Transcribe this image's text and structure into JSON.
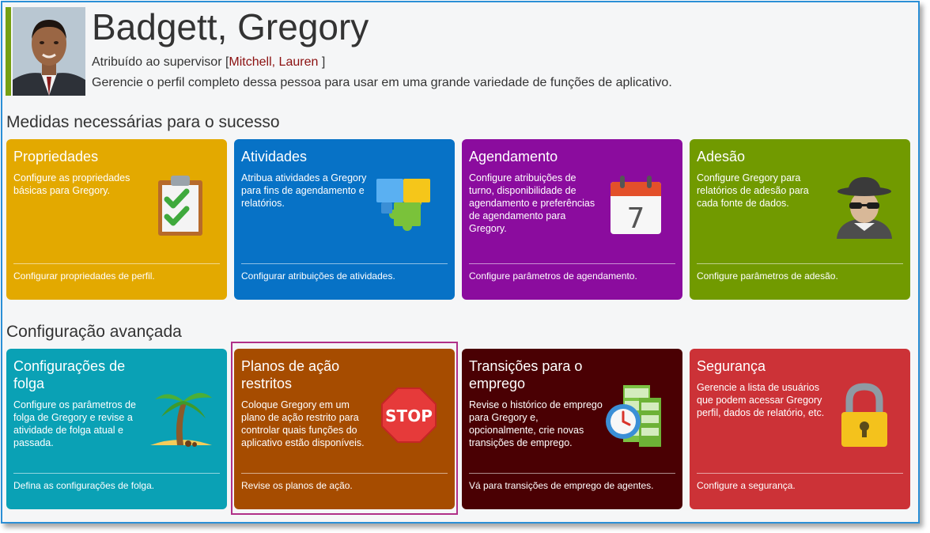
{
  "header": {
    "name": "Badgett, Gregory",
    "supervisor_prefix": "Atribuído ao supervisor [",
    "supervisor_name": "Mitchell, Lauren",
    "supervisor_suffix": " ]",
    "description": "Gerencie o perfil completo dessa pessoa para usar em uma grande variedade de funções de aplicativo."
  },
  "sections": {
    "success": "Medidas necessárias para o sucesso",
    "advanced": "Configuração avançada"
  },
  "tiles": [
    {
      "title": "Propriedades",
      "desc": "Configure as propriedades básicas para Gregory.",
      "footer": "Configurar propriedades de perfil.",
      "icon": "clipboard-check-icon",
      "color": "#e3a900"
    },
    {
      "title": "Atividades",
      "desc": "Atribua atividades a Gregory para fins de agendamento e relatórios.",
      "footer": "Configurar atribuições de atividades.",
      "icon": "puzzle-icon",
      "color": "#0772c6"
    },
    {
      "title": "Agendamento",
      "desc": "Configure atribuições de turno, disponibilidade de agendamento e preferências de agendamento para Gregory.",
      "footer": "Configure parâmetros de agendamento.",
      "icon": "calendar-icon",
      "color": "#8b0c9e"
    },
    {
      "title": "Adesão",
      "desc": "Configure Gregory para relatórios de adesão para cada fonte de dados.",
      "footer": "Configure parâmetros de adesão.",
      "icon": "spy-icon",
      "color": "#719a00"
    },
    {
      "title": "Configurações de folga",
      "desc": "Configure os parâmetros de folga de Gregory e revise a atividade de folga atual e passada.",
      "footer": "Defina as configurações de folga.",
      "icon": "palm-tree-icon",
      "color": "#0aa1b5"
    },
    {
      "title": "Planos de ação restritos",
      "desc": "Coloque Gregory em um plano de ação restrito para controlar quais funções do aplicativo estão disponíveis.",
      "footer": "Revise os planos de ação.",
      "icon": "stop-sign-icon",
      "color": "#a64c00"
    },
    {
      "title": "Transições para o emprego",
      "desc": "Revise o histórico de emprego para Gregory e, opcionalmente, crie novas transições de emprego.",
      "footer": "Vá para transições de emprego de agentes.",
      "icon": "clock-film-icon",
      "color": "#4a0003"
    },
    {
      "title": "Segurança",
      "desc": "Gerencie a lista de usuários que podem acessar Gregory perfil, dados de relatório, etc.",
      "footer": "Configure a segurança.",
      "icon": "padlock-icon",
      "color": "#cc3237"
    }
  ]
}
